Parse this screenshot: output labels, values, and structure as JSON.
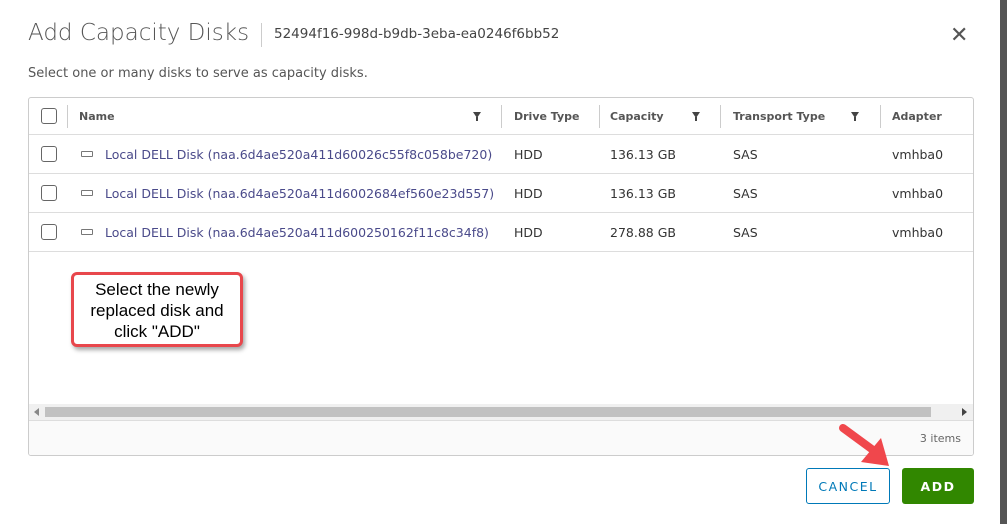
{
  "dialog": {
    "title": "Add Capacity Disks",
    "subtitle": "52494f16-998d-b9db-3eba-ea0246f6bb52",
    "description": "Select one or many disks to serve as capacity disks."
  },
  "table": {
    "columns": [
      "Name",
      "Drive Type",
      "Capacity",
      "Transport Type",
      "Adapter"
    ],
    "rows": [
      {
        "name": "Local DELL Disk (naa.6d4ae520a411d60026c55f8c058be720)",
        "drive": "HDD",
        "capacity": "136.13 GB",
        "transport": "SAS",
        "adapter": "vmhba0"
      },
      {
        "name": "Local DELL Disk (naa.6d4ae520a411d6002684ef560e23d557)",
        "drive": "HDD",
        "capacity": "136.13 GB",
        "transport": "SAS",
        "adapter": "vmhba0"
      },
      {
        "name": "Local DELL Disk (naa.6d4ae520a411d600250162f11c8c34f8)",
        "drive": "HDD",
        "capacity": "278.88 GB",
        "transport": "SAS",
        "adapter": "vmhba0"
      }
    ],
    "footer": "3 items"
  },
  "annotation": "Select the newly replaced disk and click \"ADD\"",
  "buttons": {
    "cancel": "CANCEL",
    "add": "ADD"
  },
  "colors": {
    "primary": "#318700",
    "link": "#0079b8",
    "callout": "#e8474c"
  }
}
